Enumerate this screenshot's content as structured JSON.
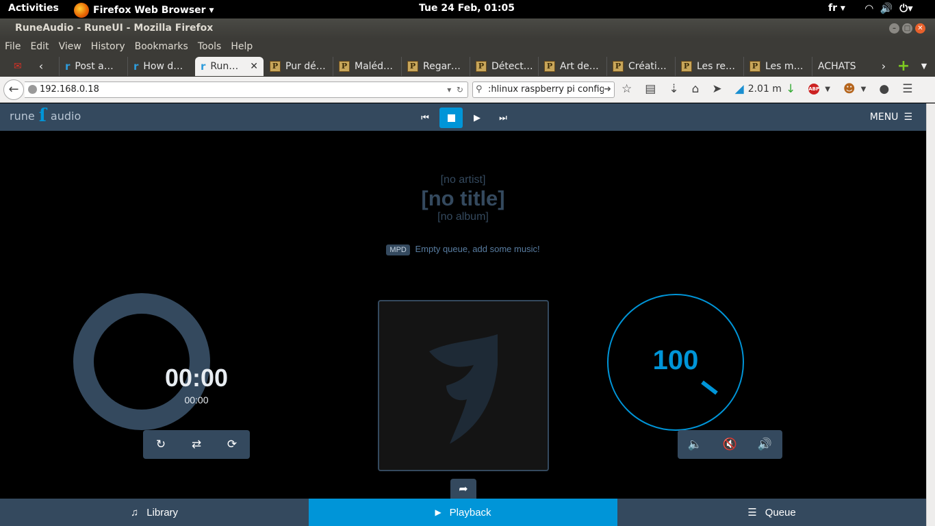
{
  "gnome": {
    "activities": "Activities",
    "app_name": "Firefox Web Browser ▾",
    "clock": "Tue 24 Feb, 01:05",
    "lang": "fr ▾",
    "wifi_icon": "◠",
    "speaker_icon": "🔊",
    "power_icon": "⏻▾"
  },
  "window": {
    "title": "RuneAudio - RuneUI - Mozilla Firefox"
  },
  "menubar": [
    "File",
    "Edit",
    "View",
    "History",
    "Bookmarks",
    "Tools",
    "Help"
  ],
  "tabs": [
    {
      "label": "Post a…",
      "favicon": "r"
    },
    {
      "label": "How d…",
      "favicon": "r"
    },
    {
      "label": "Run…",
      "favicon": "r",
      "close": "✕"
    },
    {
      "label": "Pur dé…",
      "favicon": "P"
    },
    {
      "label": "Maléd…",
      "favicon": "P"
    },
    {
      "label": "Regar…",
      "favicon": "P"
    },
    {
      "label": "Détect…",
      "favicon": "P"
    },
    {
      "label": "Art de…",
      "favicon": "P"
    },
    {
      "label": "Créati…",
      "favicon": "P"
    },
    {
      "label": "Les re…",
      "favicon": "P"
    },
    {
      "label": "Les m…",
      "favicon": "P"
    },
    {
      "label": "ACHATS",
      "favicon": ""
    }
  ],
  "navbar": {
    "url": "192.168.0.18",
    "search_value": ":hlinux raspberry pi config",
    "download_rate": "2.01 m"
  },
  "rune": {
    "logo_left": "rune",
    "logo_right": "audio",
    "menu_label": "MENU",
    "artist": "[no artist]",
    "title": "[no title]",
    "album": "[no album]",
    "badge": "MPD",
    "status": "Empty queue, add some music!",
    "elapsed": "00:00",
    "total": "00:00",
    "progress": 0,
    "volume": "100",
    "volume_level": 1.0,
    "nav": {
      "library": "Library",
      "playback": "Playback",
      "queue": "Queue"
    },
    "colors": {
      "accent": "#0095d8",
      "panel": "#34495e"
    }
  }
}
